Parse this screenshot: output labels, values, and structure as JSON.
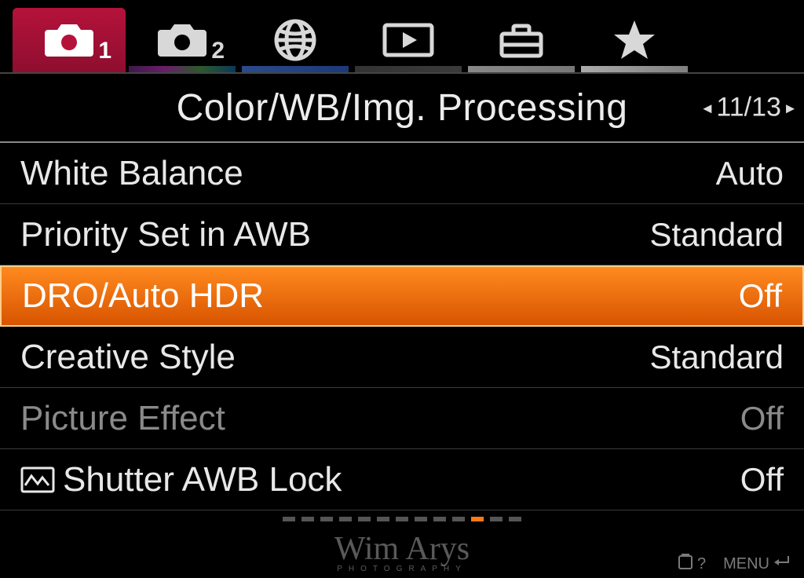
{
  "tabs": {
    "camera1_badge": "1",
    "camera2_badge": "2"
  },
  "section": {
    "title": "Color/WB/Img. Processing",
    "page_label": "11/13"
  },
  "menu": [
    {
      "label": "White Balance",
      "value": "Auto",
      "state": "normal"
    },
    {
      "label": "Priority Set in AWB",
      "value": "Standard",
      "state": "normal"
    },
    {
      "label": "DRO/Auto HDR",
      "value": "Off",
      "state": "selected"
    },
    {
      "label": "Creative Style",
      "value": "Standard",
      "state": "normal"
    },
    {
      "label": "Picture Effect",
      "value": "Off",
      "state": "disabled"
    },
    {
      "label": "Shutter AWB Lock",
      "value": "Off",
      "state": "normal",
      "icon": "awb-lock-icon"
    }
  ],
  "hints": {
    "q": "?",
    "menu": "MENU"
  },
  "watermark": {
    "line1": "Wim Arys",
    "line2": "PHOTOGRAPHY"
  }
}
